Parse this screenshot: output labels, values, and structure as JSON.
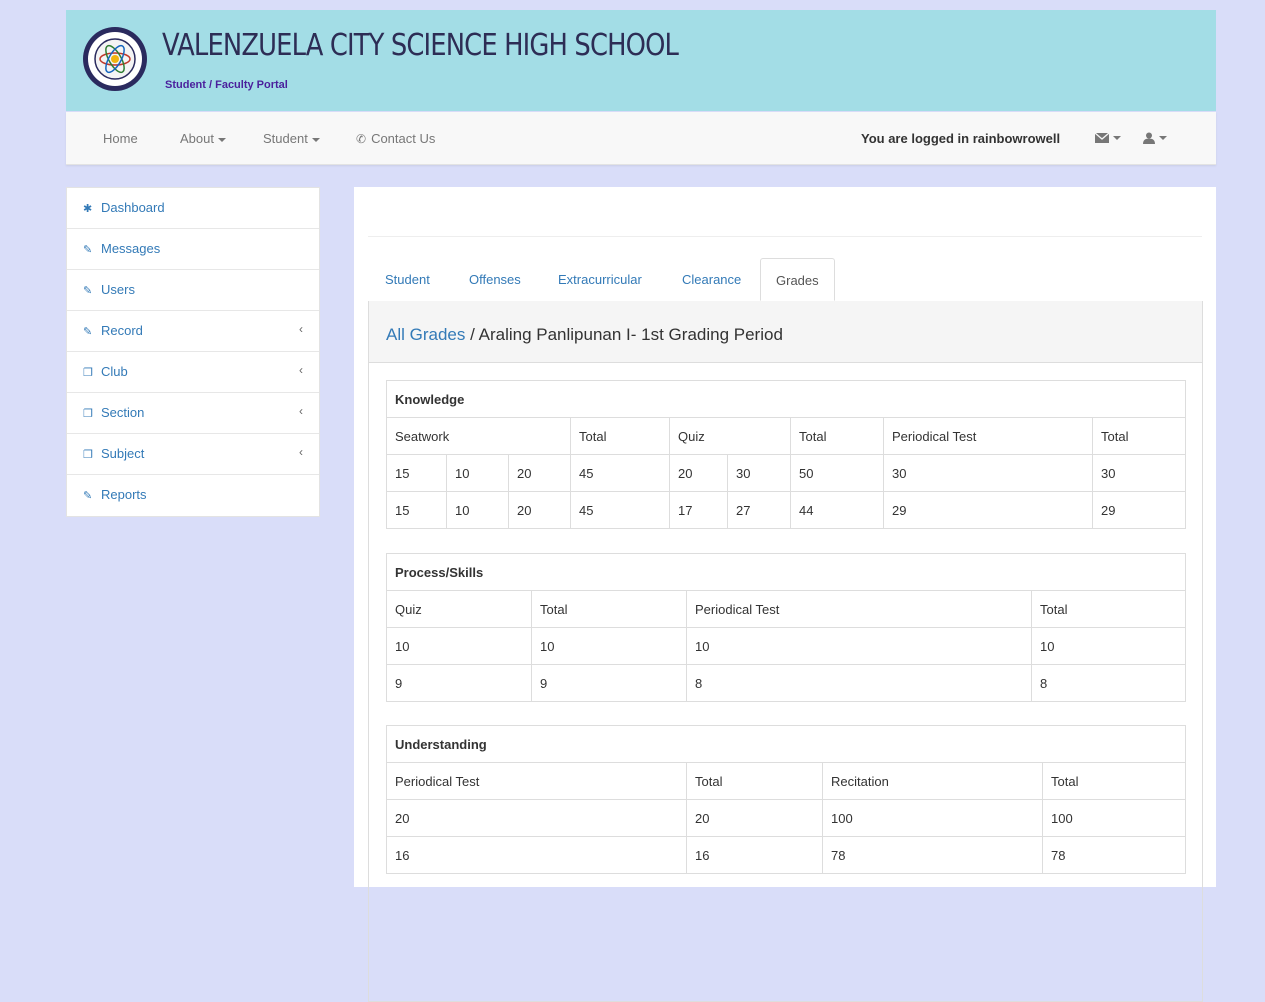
{
  "header": {
    "school_name": "VALENZUELA CITY SCIENCE HIGH SCHOOL",
    "subtitle": "Student / Faculty Portal",
    "logo_icon": "school-seal-icon",
    "colors": {
      "header_bg": "#a3dde6",
      "subtitle": "#4a1f9c",
      "accent": "#337ab7"
    }
  },
  "nav": {
    "home": "Home",
    "about": "About",
    "student": "Student",
    "contact": "Contact Us",
    "logged_in": "You are logged in rainbowrowell"
  },
  "sidebar": {
    "items": [
      {
        "label": "Dashboard",
        "icon": "dashboard-icon"
      },
      {
        "label": "Messages",
        "icon": "edit-icon"
      },
      {
        "label": "Users",
        "icon": "edit-icon"
      },
      {
        "label": "Record",
        "icon": "edit-icon",
        "has_submenu": true
      },
      {
        "label": "Club",
        "icon": "copy-icon",
        "has_submenu": true
      },
      {
        "label": "Section",
        "icon": "copy-icon",
        "has_submenu": true
      },
      {
        "label": "Subject",
        "icon": "copy-icon",
        "has_submenu": true
      },
      {
        "label": "Reports",
        "icon": "edit-icon"
      }
    ]
  },
  "tabs": [
    "Student",
    "Offenses",
    "Extracurricular",
    "Clearance",
    "Grades"
  ],
  "active_tab": "Grades",
  "breadcrumb": {
    "link": "All Grades",
    "separator": " / ",
    "current": "Araling Panlipunan I- 1st Grading Period"
  },
  "knowledge": {
    "title": "Knowledge",
    "headers": [
      "Seatwork",
      "Total",
      "Quiz",
      "Total",
      "Periodical Test",
      "Total"
    ],
    "rows": [
      [
        "15",
        "10",
        "20",
        "45",
        "20",
        "30",
        "50",
        "30",
        "30"
      ],
      [
        "15",
        "10",
        "20",
        "45",
        "17",
        "27",
        "44",
        "29",
        "29"
      ]
    ]
  },
  "process": {
    "title": "Process/Skills",
    "headers": [
      "Quiz",
      "Total",
      "Periodical Test",
      "Total"
    ],
    "rows": [
      [
        "10",
        "10",
        "10",
        "10"
      ],
      [
        "9",
        "9",
        "8",
        "8"
      ]
    ]
  },
  "understanding": {
    "title": "Understanding",
    "headers": [
      "Periodical Test",
      "Total",
      "Recitation",
      "Total"
    ],
    "rows": [
      [
        "20",
        "20",
        "100",
        "100"
      ],
      [
        "16",
        "16",
        "78",
        "78"
      ]
    ]
  }
}
